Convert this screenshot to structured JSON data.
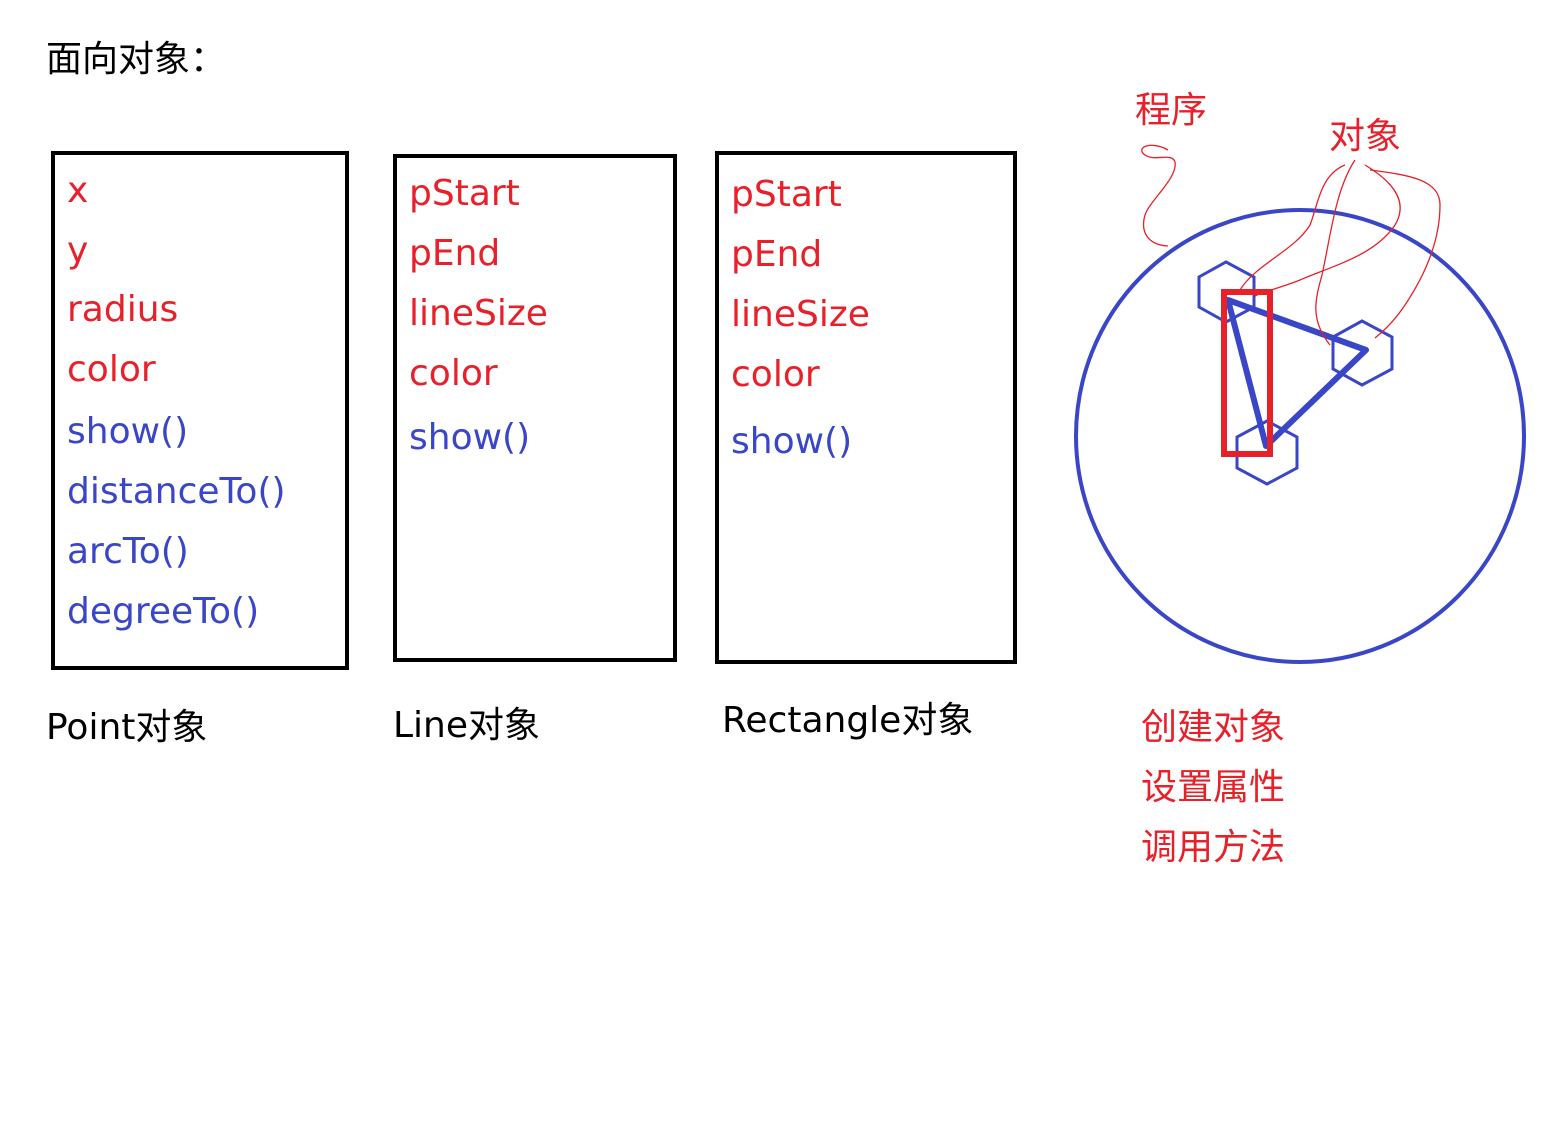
{
  "title": "面向对象：",
  "colors": {
    "property": "#e8202a",
    "method": "#3a46c8",
    "annotation": "#e8202a",
    "sketch_blue": "#3a46c8",
    "sketch_red": "#e8202a"
  },
  "classes": {
    "point": {
      "properties": [
        "x",
        "y",
        "radius",
        "color"
      ],
      "methods": [
        "show()",
        "distanceTo()",
        "arcTo()",
        "degreeTo()"
      ],
      "caption": "Point对象"
    },
    "line": {
      "properties": [
        "pStart",
        "pEnd",
        "lineSize",
        "color"
      ],
      "methods": [
        "show()"
      ],
      "caption": "Line对象"
    },
    "rect": {
      "properties": [
        "pStart",
        "pEnd",
        "lineSize",
        "color"
      ],
      "methods": [
        "show()"
      ],
      "caption": "Rectangle对象"
    }
  },
  "annotations": {
    "program": "程序",
    "object": "对象",
    "steps": [
      "创建对象",
      "设置属性",
      "调用方法"
    ]
  }
}
